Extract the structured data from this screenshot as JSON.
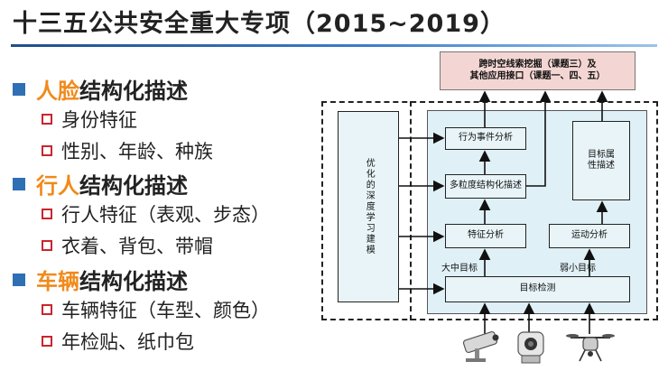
{
  "title": "十三五公共安全重大专项（2015~2019）",
  "sections": [
    {
      "accent": "人脸",
      "rest": "结构化描述",
      "items": [
        "身份特征",
        "性别、年龄、种族"
      ]
    },
    {
      "accent": "行人",
      "rest": "结构化描述",
      "items": [
        "行人特征（表观、步态）",
        "衣着、背包、带帽"
      ]
    },
    {
      "accent": "车辆",
      "rest": "结构化描述",
      "items": [
        "车辆特征（车型、颜色）",
        "年检贴、纸巾包"
      ]
    }
  ],
  "diagram": {
    "top_box_line1": "跨时空线索挖掘（课题三）及",
    "top_box_line2": "其他应用接口（课题一、四、五）",
    "left_box": "优化的深度学习建模",
    "behavior": "行为事件分析",
    "multigranular": "多粒度结构化描述",
    "feature": "特征分析",
    "motion": "运动分析",
    "target_attr_line1": "目标属",
    "target_attr_line2": "性描述",
    "detection": "目标检测",
    "large_target": "大中目标",
    "small_target": "弱小目标"
  },
  "colors": {
    "accent": "#f08a1c",
    "bullet": "#2f6fb3",
    "checkbox": "#c9252d",
    "panel": "#dff0f6",
    "top_box": "#f3d6d3"
  },
  "icons": [
    "security-camera-icon",
    "ptz-dome-camera-icon",
    "drone-icon"
  ]
}
